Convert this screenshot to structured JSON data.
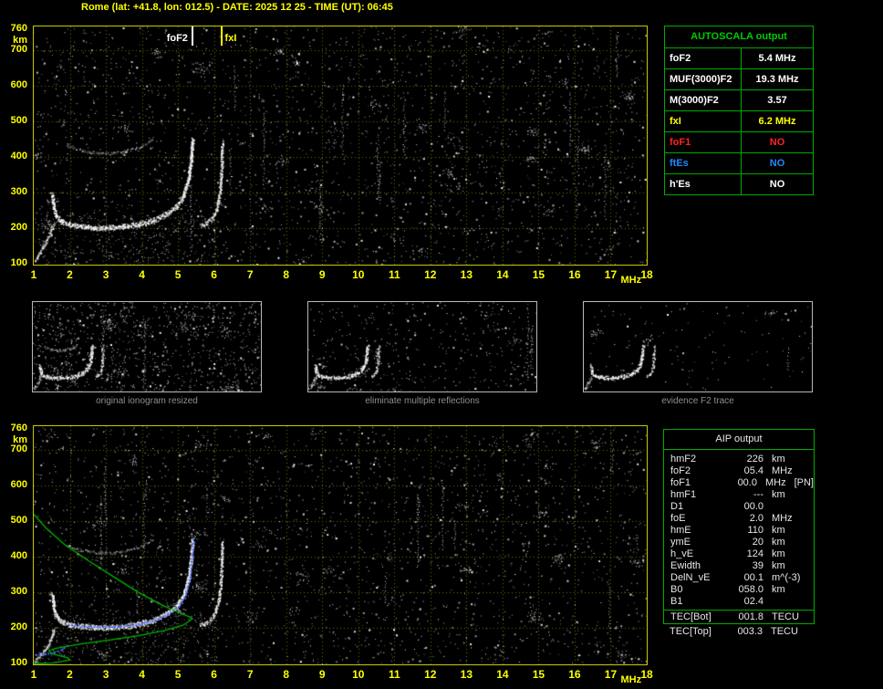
{
  "title": "Rome (lat: +41.8, lon: 012.5) - DATE: 2025 12 25 - TIME (UT): 06:45",
  "colors": {
    "axis_text": "#ffff00",
    "plot_border": "#c8c800",
    "grid": "#6e6e00",
    "table_border": "#00aa00",
    "table_header_green": "#00cc00",
    "trace_white": "#ffffff",
    "profile_green": "#00b400",
    "restored_blue": "#4a6aff",
    "caption_gray": "#8f8f8f"
  },
  "autoscala_table": {
    "header": "AUTOSCALA output",
    "rows": [
      {
        "label": "foF2",
        "value": "5.4 MHz",
        "color": "#ffffff"
      },
      {
        "label": "MUF(3000)F2",
        "value": "19.3 MHz",
        "color": "#ffffff"
      },
      {
        "label": "M(3000)F2",
        "value": "3.57",
        "color": "#ffffff"
      },
      {
        "label": "fxI",
        "value": "6.2 MHz",
        "color": "#ffff00"
      },
      {
        "label": "foF1",
        "value": "NO",
        "color": "#ff2222"
      },
      {
        "label": "ftEs",
        "value": "NO",
        "color": "#2288ff"
      },
      {
        "label": "h'Es",
        "value": "NO",
        "color": "#ffffff"
      }
    ]
  },
  "aip_table": {
    "header": "AIP output",
    "rows": [
      {
        "label": "hmF2",
        "value": "226",
        "unit": "km",
        "extra": ""
      },
      {
        "label": "foF2",
        "value": "05.4",
        "unit": "MHz",
        "extra": ""
      },
      {
        "label": "foF1",
        "value": "00.0",
        "unit": "MHz",
        "extra": "[PN]"
      },
      {
        "label": "hmF1",
        "value": "---",
        "unit": "km",
        "extra": ""
      },
      {
        "label": "D1",
        "value": "00.0",
        "unit": "",
        "extra": ""
      },
      {
        "label": "foE",
        "value": "2.0",
        "unit": "MHz",
        "extra": ""
      },
      {
        "label": "hmE",
        "value": "110",
        "unit": "km",
        "extra": ""
      },
      {
        "label": "ymE",
        "value": "20",
        "unit": "km",
        "extra": ""
      },
      {
        "label": "h_vE",
        "value": "124",
        "unit": "km",
        "extra": ""
      },
      {
        "label": "Ewidth",
        "value": "39",
        "unit": "km",
        "extra": ""
      },
      {
        "label": "DelN_vE",
        "value": "00.1",
        "unit": "m^(-3)",
        "extra": ""
      },
      {
        "label": "B0",
        "value": "058.0",
        "unit": "km",
        "extra": ""
      },
      {
        "label": "B1",
        "value": "02.4",
        "unit": "",
        "extra": ""
      }
    ],
    "tec_rows": [
      {
        "label": "TEC[Bot]",
        "value": "001.8",
        "unit": "TECU"
      },
      {
        "label": "TEC[Top]",
        "value": "003.3",
        "unit": "TECU"
      }
    ]
  },
  "thumbnails": [
    {
      "caption": "original ionogram resized"
    },
    {
      "caption": "eliminate multiple reflections"
    },
    {
      "caption": "evidence F2 trace"
    }
  ],
  "chart_data": [
    {
      "id": "top_ionogram",
      "type": "scatter",
      "xlabel": "MHz",
      "ylabel": "km",
      "xlim": [
        1,
        18
      ],
      "ylim": [
        100,
        760
      ],
      "xticks": [
        1,
        2,
        3,
        4,
        5,
        6,
        7,
        8,
        9,
        10,
        11,
        12,
        13,
        14,
        15,
        16,
        17,
        18
      ],
      "yticks": [
        760,
        700,
        600,
        500,
        400,
        300,
        200,
        100
      ],
      "grid": true,
      "markers": [
        {
          "label": "foF2",
          "freq_mhz": 5.4,
          "color": "#ffffff"
        },
        {
          "label": "fxI",
          "freq_mhz": 6.2,
          "color": "#ffff00"
        }
      ],
      "e_trace": [
        [
          1.02,
          110
        ],
        [
          1.15,
          132
        ],
        [
          1.3,
          158
        ],
        [
          1.45,
          188
        ],
        [
          1.52,
          212
        ]
      ],
      "o_trace": [
        [
          1.5,
          300
        ],
        [
          1.55,
          262
        ],
        [
          1.62,
          238
        ],
        [
          1.75,
          224
        ],
        [
          1.95,
          216
        ],
        [
          2.3,
          210
        ],
        [
          2.7,
          206
        ],
        [
          3.1,
          206
        ],
        [
          3.5,
          209
        ],
        [
          3.9,
          215
        ],
        [
          4.3,
          226
        ],
        [
          4.65,
          243
        ],
        [
          4.95,
          266
        ],
        [
          5.15,
          296
        ],
        [
          5.28,
          340
        ],
        [
          5.36,
          400
        ],
        [
          5.4,
          455
        ]
      ],
      "x_trace": [
        [
          5.62,
          210
        ],
        [
          5.8,
          218
        ],
        [
          5.95,
          232
        ],
        [
          6.05,
          252
        ],
        [
          6.13,
          285
        ],
        [
          6.18,
          330
        ],
        [
          6.21,
          390
        ],
        [
          6.22,
          445
        ]
      ],
      "second_hop": [
        [
          1.9,
          435
        ],
        [
          2.3,
          420
        ],
        [
          2.8,
          412
        ],
        [
          3.2,
          412
        ],
        [
          3.6,
          420
        ],
        [
          4.0,
          432
        ],
        [
          4.3,
          450
        ]
      ]
    },
    {
      "id": "bottom_ionogram",
      "type": "scatter",
      "xlabel": "MHz",
      "ylabel": "km",
      "xlim": [
        1,
        18
      ],
      "ylim": [
        100,
        760
      ],
      "xticks": [
        1,
        2,
        3,
        4,
        5,
        6,
        7,
        8,
        9,
        10,
        11,
        12,
        13,
        14,
        15,
        16,
        17,
        18
      ],
      "yticks": [
        760,
        700,
        600,
        500,
        400,
        300,
        200,
        100
      ],
      "grid": true,
      "e_trace": [
        [
          1.02,
          108
        ],
        [
          1.2,
          128
        ],
        [
          1.38,
          152
        ],
        [
          1.5,
          178
        ],
        [
          1.55,
          200
        ]
      ],
      "o_trace": [
        [
          1.5,
          300
        ],
        [
          1.55,
          262
        ],
        [
          1.62,
          238
        ],
        [
          1.75,
          224
        ],
        [
          1.95,
          216
        ],
        [
          2.3,
          210
        ],
        [
          2.7,
          206
        ],
        [
          3.1,
          206
        ],
        [
          3.5,
          209
        ],
        [
          3.9,
          215
        ],
        [
          4.3,
          226
        ],
        [
          4.65,
          243
        ],
        [
          4.95,
          266
        ],
        [
          5.15,
          296
        ],
        [
          5.28,
          340
        ],
        [
          5.36,
          400
        ],
        [
          5.4,
          455
        ]
      ],
      "x_trace": [
        [
          5.62,
          210
        ],
        [
          5.8,
          218
        ],
        [
          5.95,
          232
        ],
        [
          6.05,
          252
        ],
        [
          6.13,
          285
        ],
        [
          6.18,
          330
        ],
        [
          6.21,
          390
        ],
        [
          6.22,
          445
        ]
      ],
      "second_hop": [
        [
          1.9,
          435
        ],
        [
          2.3,
          420
        ],
        [
          2.8,
          412
        ],
        [
          3.2,
          412
        ],
        [
          3.6,
          420
        ],
        [
          4.0,
          432
        ],
        [
          4.3,
          450
        ]
      ],
      "restored_e": [
        [
          1.05,
          126
        ],
        [
          1.3,
          128
        ],
        [
          1.55,
          133
        ],
        [
          1.75,
          140
        ],
        [
          1.9,
          152
        ]
      ],
      "restored_f": [
        [
          1.95,
          212
        ],
        [
          2.4,
          206
        ],
        [
          2.9,
          204
        ],
        [
          3.4,
          206
        ],
        [
          3.9,
          212
        ],
        [
          4.35,
          224
        ],
        [
          4.7,
          240
        ],
        [
          5.0,
          262
        ],
        [
          5.2,
          295
        ],
        [
          5.32,
          345
        ],
        [
          5.38,
          405
        ],
        [
          5.4,
          450
        ]
      ],
      "profile": [
        [
          1.0,
          520
        ],
        [
          1.35,
          480
        ],
        [
          1.85,
          435
        ],
        [
          2.5,
          390
        ],
        [
          3.2,
          345
        ],
        [
          3.9,
          300
        ],
        [
          4.6,
          262
        ],
        [
          5.1,
          240
        ],
        [
          5.35,
          230
        ],
        [
          5.4,
          226
        ],
        [
          5.15,
          208
        ],
        [
          4.6,
          192
        ],
        [
          3.9,
          178
        ],
        [
          3.1,
          166
        ],
        [
          2.4,
          156
        ],
        [
          1.9,
          148
        ],
        [
          1.6,
          142
        ],
        [
          1.42,
          136
        ],
        [
          1.48,
          128
        ],
        [
          1.7,
          122
        ],
        [
          1.95,
          116
        ],
        [
          2.0,
          110
        ],
        [
          1.8,
          106
        ],
        [
          1.5,
          101
        ],
        [
          1.2,
          96
        ],
        [
          1.02,
          92
        ]
      ]
    }
  ]
}
